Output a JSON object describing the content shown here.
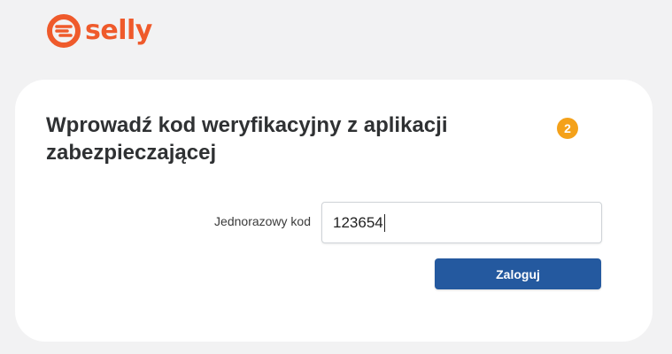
{
  "brand": {
    "name": "selly",
    "color": "#ef5a2b"
  },
  "verification": {
    "title": "Wprowadź kod weryfikacyjny z aplikacji zabezpieczającej",
    "step_badge": "2",
    "code_label": "Jednorazowy kod",
    "code_value": "123654",
    "login_label": "Zaloguj"
  },
  "colors": {
    "primary_button": "#24599f",
    "badge": "#f4a11a",
    "background": "#f2f2f3"
  }
}
